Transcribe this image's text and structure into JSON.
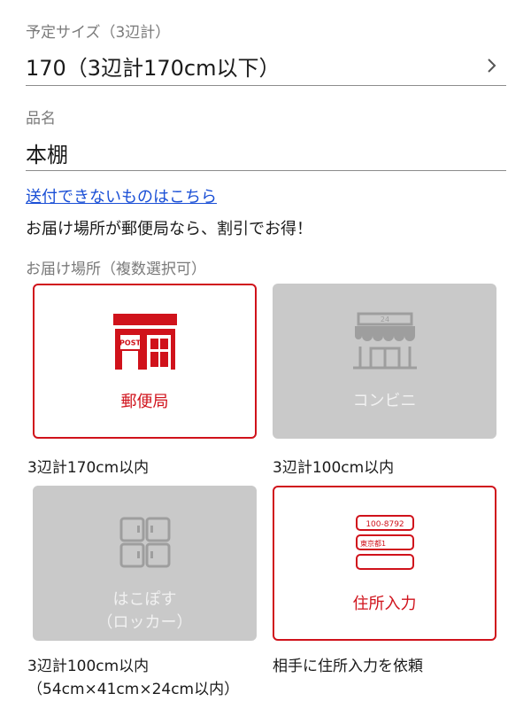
{
  "size": {
    "label": "予定サイズ（3辺計）",
    "value": "170（3辺計170cm以下）"
  },
  "item": {
    "label": "品名",
    "value": "本棚"
  },
  "cannot_send_link": "送付できないものはこちら",
  "promo_text": "お届け場所が郵便局なら、割引でお得！",
  "destination_label": "お届け場所（複数選択可）",
  "destinations": [
    {
      "label": "郵便局",
      "note": "3辺計170cm以内",
      "state": "selected",
      "icon": "post-office-icon"
    },
    {
      "label": "コンビニ",
      "note": "3辺計100cm以内",
      "state": "disabled",
      "icon": "convenience-store-icon",
      "icon_text": "24"
    },
    {
      "label_line1": "はこぽす",
      "label_line2": "（ロッカー）",
      "note_line1": "3辺計100cm以内",
      "note_line2": "（54cm×41cm×24cm以内）",
      "state": "disabled",
      "icon": "locker-icon"
    },
    {
      "label": "住所入力",
      "note": "相手に住所入力を依頼",
      "state": "selected",
      "icon": "address-form-icon",
      "postal_code": "100-8792",
      "prefecture": "東京都1"
    }
  ],
  "post_sign_text": "POST",
  "colors": {
    "accent": "#d0121b",
    "disabled_bg": "#c9c9c9",
    "link": "#1a4fd6"
  }
}
